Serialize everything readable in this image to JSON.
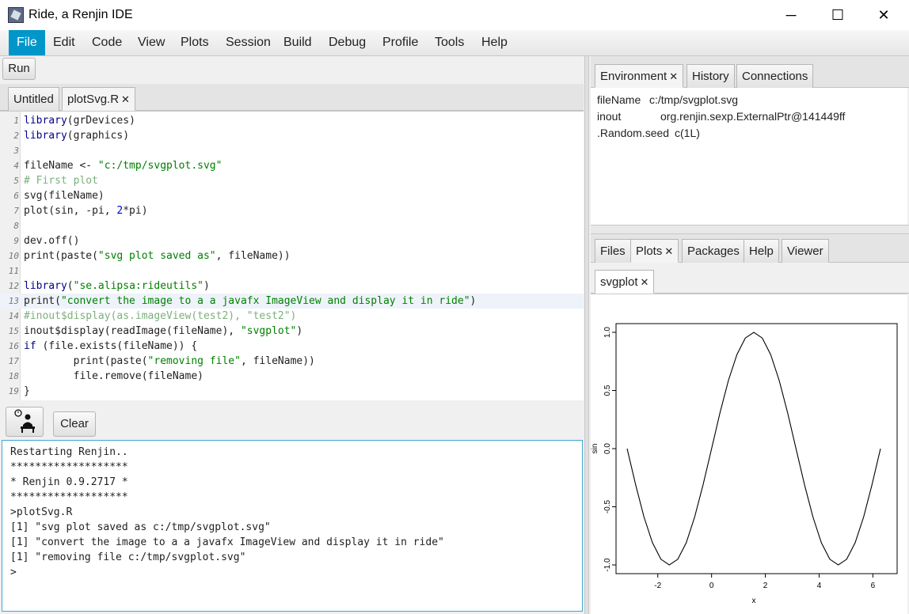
{
  "window": {
    "title": "Ride, a Renjin IDE",
    "minimize": "─",
    "maximize": "☐",
    "close": "✕"
  },
  "menu": [
    "File",
    "Edit",
    "Code",
    "View",
    "Plots",
    "Session",
    "Build",
    "Debug",
    "Profile",
    "Tools",
    "Help"
  ],
  "toolbar": {
    "run_label": "Run"
  },
  "editor_tabs": [
    {
      "label": "Untitled"
    },
    {
      "label": "plotSvg.R",
      "close": "✕"
    }
  ],
  "code_lines": [
    "library(grDevices)",
    "library(graphics)",
    "",
    "fileName <- \"c:/tmp/svgplot.svg\"",
    "# First plot",
    "svg(fileName)",
    "plot(sin, -pi, 2*pi)",
    "",
    "dev.off()",
    "print(paste(\"svg plot saved as\", fileName))",
    "",
    "library(\"se.alipsa:rideutils\")",
    "print(\"convert the image to a a javafx ImageView and display it in ride\")",
    "#inout$display(as.imageView(test2), \"test2\")",
    "inout$display(readImage(fileName), \"svgplot\")",
    "if (file.exists(fileName)) {",
    "        print(paste(\"removing file\", fileName))",
    "        file.remove(fileName)",
    "}"
  ],
  "console_toolbar": {
    "clear_label": "Clear"
  },
  "console_lines": [
    "Restarting Renjin..",
    "*******************",
    "* Renjin 0.9.2717 *",
    "*******************",
    ">plotSvg.R",
    "[1] \"svg plot saved as c:/tmp/svgplot.svg\"",
    "[1] \"convert the image to a a javafx ImageView and display it in ride\"",
    "[1] \"removing file c:/tmp/svgplot.svg\"",
    ">"
  ],
  "top_right_tabs": [
    {
      "label": "Environment",
      "close": "✕"
    },
    {
      "label": "History"
    },
    {
      "label": "Connections"
    }
  ],
  "environment": [
    {
      "name": "fileName",
      "value": "c:/tmp/svgplot.svg"
    },
    {
      "name": "inout",
      "value": "org.renjin.sexp.ExternalPtr@141449ff"
    },
    {
      "name": ".Random.seed",
      "value": "c(1L)"
    }
  ],
  "bottom_right_tabs": [
    {
      "label": "Files"
    },
    {
      "label": "Plots",
      "close": "✕"
    },
    {
      "label": "Packages"
    },
    {
      "label": "Help"
    },
    {
      "label": "Viewer"
    }
  ],
  "plot_tabs": [
    {
      "label": "svgplot",
      "close": "✕"
    }
  ],
  "chart_data": {
    "type": "line",
    "function": "sin",
    "xlabel": "x",
    "ylabel": "sin",
    "xlim": [
      -3.14159,
      6.28319
    ],
    "ylim": [
      -1.0,
      1.0
    ],
    "x_ticks": [
      -2,
      0,
      2,
      4,
      6
    ],
    "x_tick_labels": [
      "-2",
      "0",
      "2",
      "4",
      "6"
    ],
    "y_ticks": [
      -1.0,
      -0.5,
      0.0,
      0.5,
      1.0
    ],
    "y_tick_labels": [
      "-1.0",
      "-0.5",
      "0.0",
      "0.5",
      "1.0"
    ],
    "series": [
      {
        "x": [
          -3.1416,
          -2.8274,
          -2.5133,
          -2.1991,
          -1.885,
          -1.5708,
          -1.2566,
          -0.9425,
          -0.6283,
          -0.3142,
          0,
          0.3142,
          0.6283,
          0.9425,
          1.2566,
          1.5708,
          1.885,
          2.1991,
          2.5133,
          2.8274,
          3.1416,
          3.4558,
          3.7699,
          4.0841,
          4.3982,
          4.7124,
          5.0265,
          5.3407,
          5.6549,
          5.969,
          6.2832
        ],
        "values": [
          0,
          -0.309,
          -0.588,
          -0.809,
          -0.951,
          -1,
          -0.951,
          -0.809,
          -0.588,
          -0.309,
          0,
          0.309,
          0.588,
          0.809,
          0.951,
          1,
          0.951,
          0.809,
          0.588,
          0.309,
          0,
          -0.309,
          -0.588,
          -0.809,
          -0.951,
          -1,
          -0.951,
          -0.809,
          -0.588,
          -0.309,
          0
        ]
      }
    ],
    "grid": false
  }
}
